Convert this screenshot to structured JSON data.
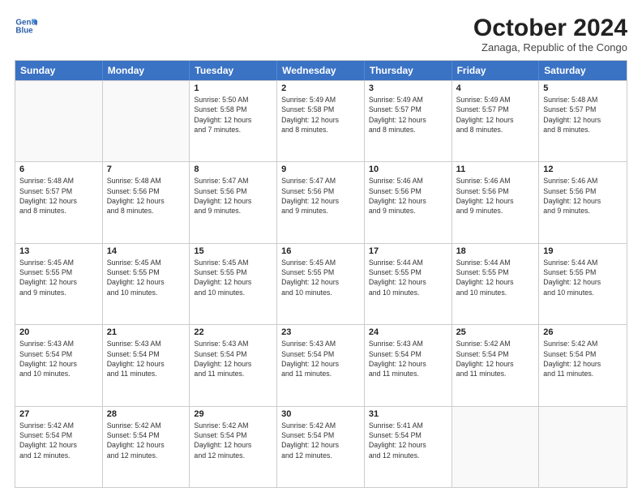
{
  "logo": {
    "line1": "General",
    "line2": "Blue"
  },
  "header": {
    "month": "October 2024",
    "location": "Zanaga, Republic of the Congo"
  },
  "days_of_week": [
    "Sunday",
    "Monday",
    "Tuesday",
    "Wednesday",
    "Thursday",
    "Friday",
    "Saturday"
  ],
  "rows": [
    [
      {
        "day": "",
        "info": ""
      },
      {
        "day": "",
        "info": ""
      },
      {
        "day": "1",
        "info": "Sunrise: 5:50 AM\nSunset: 5:58 PM\nDaylight: 12 hours\nand 7 minutes."
      },
      {
        "day": "2",
        "info": "Sunrise: 5:49 AM\nSunset: 5:58 PM\nDaylight: 12 hours\nand 8 minutes."
      },
      {
        "day": "3",
        "info": "Sunrise: 5:49 AM\nSunset: 5:57 PM\nDaylight: 12 hours\nand 8 minutes."
      },
      {
        "day": "4",
        "info": "Sunrise: 5:49 AM\nSunset: 5:57 PM\nDaylight: 12 hours\nand 8 minutes."
      },
      {
        "day": "5",
        "info": "Sunrise: 5:48 AM\nSunset: 5:57 PM\nDaylight: 12 hours\nand 8 minutes."
      }
    ],
    [
      {
        "day": "6",
        "info": "Sunrise: 5:48 AM\nSunset: 5:57 PM\nDaylight: 12 hours\nand 8 minutes."
      },
      {
        "day": "7",
        "info": "Sunrise: 5:48 AM\nSunset: 5:56 PM\nDaylight: 12 hours\nand 8 minutes."
      },
      {
        "day": "8",
        "info": "Sunrise: 5:47 AM\nSunset: 5:56 PM\nDaylight: 12 hours\nand 9 minutes."
      },
      {
        "day": "9",
        "info": "Sunrise: 5:47 AM\nSunset: 5:56 PM\nDaylight: 12 hours\nand 9 minutes."
      },
      {
        "day": "10",
        "info": "Sunrise: 5:46 AM\nSunset: 5:56 PM\nDaylight: 12 hours\nand 9 minutes."
      },
      {
        "day": "11",
        "info": "Sunrise: 5:46 AM\nSunset: 5:56 PM\nDaylight: 12 hours\nand 9 minutes."
      },
      {
        "day": "12",
        "info": "Sunrise: 5:46 AM\nSunset: 5:56 PM\nDaylight: 12 hours\nand 9 minutes."
      }
    ],
    [
      {
        "day": "13",
        "info": "Sunrise: 5:45 AM\nSunset: 5:55 PM\nDaylight: 12 hours\nand 9 minutes."
      },
      {
        "day": "14",
        "info": "Sunrise: 5:45 AM\nSunset: 5:55 PM\nDaylight: 12 hours\nand 10 minutes."
      },
      {
        "day": "15",
        "info": "Sunrise: 5:45 AM\nSunset: 5:55 PM\nDaylight: 12 hours\nand 10 minutes."
      },
      {
        "day": "16",
        "info": "Sunrise: 5:45 AM\nSunset: 5:55 PM\nDaylight: 12 hours\nand 10 minutes."
      },
      {
        "day": "17",
        "info": "Sunrise: 5:44 AM\nSunset: 5:55 PM\nDaylight: 12 hours\nand 10 minutes."
      },
      {
        "day": "18",
        "info": "Sunrise: 5:44 AM\nSunset: 5:55 PM\nDaylight: 12 hours\nand 10 minutes."
      },
      {
        "day": "19",
        "info": "Sunrise: 5:44 AM\nSunset: 5:55 PM\nDaylight: 12 hours\nand 10 minutes."
      }
    ],
    [
      {
        "day": "20",
        "info": "Sunrise: 5:43 AM\nSunset: 5:54 PM\nDaylight: 12 hours\nand 10 minutes."
      },
      {
        "day": "21",
        "info": "Sunrise: 5:43 AM\nSunset: 5:54 PM\nDaylight: 12 hours\nand 11 minutes."
      },
      {
        "day": "22",
        "info": "Sunrise: 5:43 AM\nSunset: 5:54 PM\nDaylight: 12 hours\nand 11 minutes."
      },
      {
        "day": "23",
        "info": "Sunrise: 5:43 AM\nSunset: 5:54 PM\nDaylight: 12 hours\nand 11 minutes."
      },
      {
        "day": "24",
        "info": "Sunrise: 5:43 AM\nSunset: 5:54 PM\nDaylight: 12 hours\nand 11 minutes."
      },
      {
        "day": "25",
        "info": "Sunrise: 5:42 AM\nSunset: 5:54 PM\nDaylight: 12 hours\nand 11 minutes."
      },
      {
        "day": "26",
        "info": "Sunrise: 5:42 AM\nSunset: 5:54 PM\nDaylight: 12 hours\nand 11 minutes."
      }
    ],
    [
      {
        "day": "27",
        "info": "Sunrise: 5:42 AM\nSunset: 5:54 PM\nDaylight: 12 hours\nand 12 minutes."
      },
      {
        "day": "28",
        "info": "Sunrise: 5:42 AM\nSunset: 5:54 PM\nDaylight: 12 hours\nand 12 minutes."
      },
      {
        "day": "29",
        "info": "Sunrise: 5:42 AM\nSunset: 5:54 PM\nDaylight: 12 hours\nand 12 minutes."
      },
      {
        "day": "30",
        "info": "Sunrise: 5:42 AM\nSunset: 5:54 PM\nDaylight: 12 hours\nand 12 minutes."
      },
      {
        "day": "31",
        "info": "Sunrise: 5:41 AM\nSunset: 5:54 PM\nDaylight: 12 hours\nand 12 minutes."
      },
      {
        "day": "",
        "info": ""
      },
      {
        "day": "",
        "info": ""
      }
    ]
  ]
}
